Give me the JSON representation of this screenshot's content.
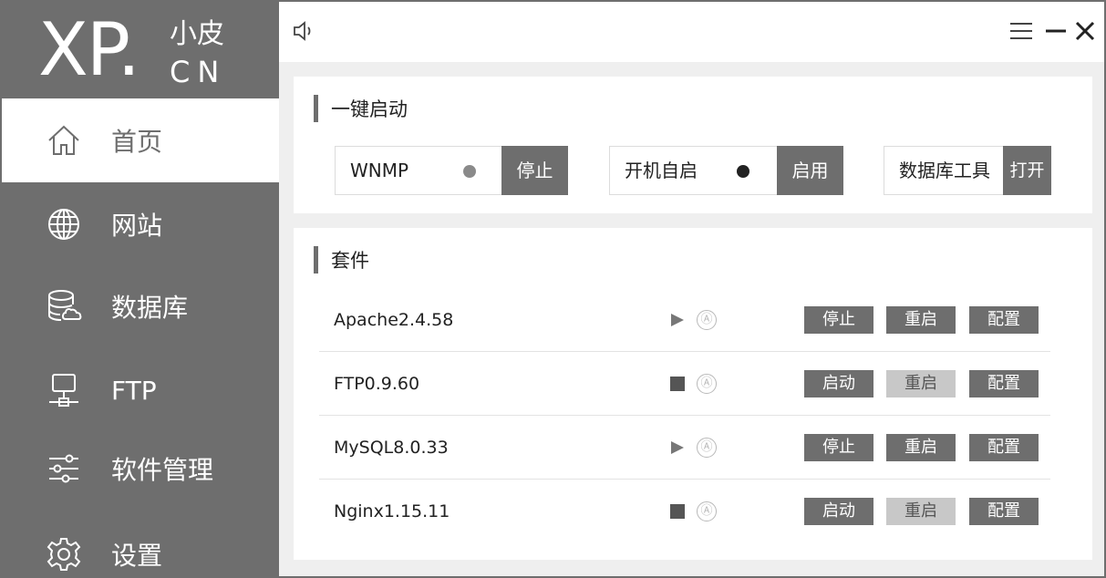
{
  "logo": {
    "main": "XP.",
    "sub": "小皮",
    "cn": "CN"
  },
  "sidebar": {
    "items": [
      {
        "label": "首页",
        "icon": "home-icon",
        "active": true
      },
      {
        "label": "网站",
        "icon": "globe-icon",
        "active": false
      },
      {
        "label": "数据库",
        "icon": "database-icon",
        "active": false
      },
      {
        "label": "FTP",
        "icon": "ftp-server-icon",
        "active": false
      },
      {
        "label": "软件管理",
        "icon": "sliders-icon",
        "active": false
      },
      {
        "label": "设置",
        "icon": "gear-icon",
        "active": false
      }
    ]
  },
  "topbar": {
    "left_icon": "speaker-icon",
    "right_icons": [
      "menu-icon",
      "minimize-icon",
      "close-icon"
    ]
  },
  "quick_start": {
    "title": "一键启动",
    "items": [
      {
        "label": "WNMP",
        "button": "停止",
        "dot_color": "#8a8a8a"
      },
      {
        "label": "开机自启",
        "button": "启用",
        "dot_color": "#222222"
      },
      {
        "label": "数据库工具",
        "button": "打开"
      }
    ]
  },
  "suite": {
    "title": "套件",
    "rows": [
      {
        "name": "Apache2.4.58",
        "state": "running",
        "auto_icon": "Ⓐ",
        "action": "停止",
        "restart": "重启",
        "restart_enabled": true,
        "config": "配置"
      },
      {
        "name": "FTP0.9.60",
        "state": "stopped",
        "auto_icon": "Ⓐ",
        "action": "启动",
        "restart": "重启",
        "restart_enabled": false,
        "config": "配置"
      },
      {
        "name": "MySQL8.0.33",
        "state": "running",
        "auto_icon": "Ⓐ",
        "action": "停止",
        "restart": "重启",
        "restart_enabled": true,
        "config": "配置"
      },
      {
        "name": "Nginx1.15.11",
        "state": "stopped",
        "auto_icon": "Ⓐ",
        "action": "启动",
        "restart": "重启",
        "restart_enabled": false,
        "config": "配置"
      }
    ]
  },
  "colors": {
    "sidebar": "#6e6e6e",
    "button": "#6e6e6e",
    "button_disabled": "#c8c8c8",
    "background": "#efefef"
  }
}
